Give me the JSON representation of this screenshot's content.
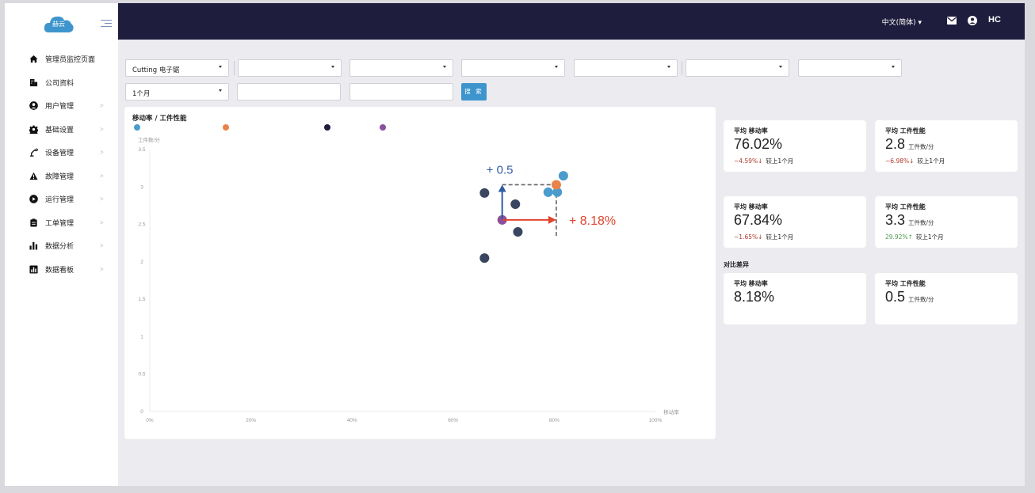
{
  "app": {
    "logo_text": "赫云",
    "accent": "#3e95cd",
    "topbar_color": "#1f1d3d"
  },
  "topbar": {
    "language": "中文(简体) ▾",
    "icons": [
      "mail-icon",
      "user-circle-icon",
      "hc-logo-icon"
    ],
    "hc_text": "HC"
  },
  "sidebar": {
    "items": [
      {
        "label": "管理员监控页面",
        "icon": "home-icon",
        "chevron": false
      },
      {
        "label": "公司资料",
        "icon": "building-icon",
        "chevron": false
      },
      {
        "label": "用户管理",
        "icon": "user-circle-icon",
        "chevron": true
      },
      {
        "label": "基础设置",
        "icon": "gear-icon",
        "chevron": true
      },
      {
        "label": "设备管理",
        "icon": "robot-arm-icon",
        "chevron": true
      },
      {
        "label": "故障管理",
        "icon": "warning-icon",
        "chevron": true
      },
      {
        "label": "运行管理",
        "icon": "play-icon",
        "chevron": true
      },
      {
        "label": "工单管理",
        "icon": "clipboard-icon",
        "chevron": true
      },
      {
        "label": "数据分析",
        "icon": "bar-chart-icon",
        "chevron": true
      },
      {
        "label": "数据看板",
        "icon": "dashboard-icon",
        "chevron": true
      }
    ],
    "chevron_glyph": ">"
  },
  "filters": {
    "row1": [
      "Cutting 电子锯",
      "",
      "",
      "",
      "",
      "",
      ""
    ],
    "period": "1个月",
    "search_label": "搜 索"
  },
  "chart": {
    "title": "移动率 / 工件性能",
    "y_unit": "工件数/分",
    "x_axis_label": "移动率",
    "annotation_up": "+ 0.5",
    "annotation_right": "+ 8.18%"
  },
  "chart_data": {
    "type": "scatter",
    "title": "移动率 / 工件性能",
    "xlabel": "移动率",
    "ylabel": "工件数/分",
    "xlim": [
      0,
      100
    ],
    "ylim": [
      0,
      3.5
    ],
    "x_ticks": [
      "0%",
      "20%",
      "40%",
      "60%",
      "80%",
      "100%"
    ],
    "y_ticks": [
      "0",
      "0.5",
      "1",
      "1.5",
      "2",
      "2.5",
      "3",
      "3.5"
    ],
    "legend_colors": [
      "#4b9ccc",
      "#e8834a",
      "#1f1d3d",
      "#8b4f9e"
    ],
    "series": [
      {
        "color": "#4b9ccc",
        "points": [
          [
            81.8,
            3.15
          ],
          [
            78.8,
            2.93
          ],
          [
            80.6,
            2.93
          ]
        ]
      },
      {
        "color": "#e8834a",
        "points": [
          [
            80.4,
            3.03
          ]
        ]
      },
      {
        "color": "#3a4660",
        "points": [
          [
            66.2,
            2.92
          ],
          [
            72.3,
            2.77
          ],
          [
            72.8,
            2.4
          ],
          [
            66.2,
            2.05
          ]
        ]
      },
      {
        "color": "#8b4f9e",
        "points": [
          [
            69.7,
            2.56
          ]
        ]
      }
    ],
    "annotations": {
      "arrow_up": {
        "from": [
          69.7,
          2.56
        ],
        "to": [
          69.7,
          3.03
        ],
        "label": "+ 0.5",
        "color": "#2f5ba3"
      },
      "arrow_right": {
        "from": [
          69.7,
          2.56
        ],
        "to": [
          80.4,
          2.56
        ],
        "label": "+ 8.18%",
        "color": "#e0452f"
      },
      "dashed_guide": {
        "from": [
          69.7,
          3.03
        ],
        "corner": [
          80.4,
          3.03
        ],
        "to": [
          80.4,
          2.33
        ]
      }
    }
  },
  "stats": {
    "top": {
      "util": {
        "label": "平均 移动率",
        "value": "76.02%",
        "delta": "−4.59%",
        "arrow": "↓",
        "cmp": "较上1个月",
        "delta_color": "#b03a2e"
      },
      "perf": {
        "label": "平均 工件性能",
        "value": "2.8",
        "unit": "工件数/分",
        "delta": "−6.98%",
        "arrow": "↓",
        "cmp": "较上1个月",
        "delta_color": "#b03a2e"
      }
    },
    "mid": {
      "util": {
        "label": "平均 移动率",
        "value": "67.84%",
        "delta": "−1.65%",
        "arrow": "↓",
        "cmp": "较上1个月",
        "delta_color": "#b03a2e"
      },
      "perf": {
        "label": "平均 工件性能",
        "value": "3.3",
        "unit": "工件数/分",
        "delta": "29.92%",
        "arrow": "↑",
        "cmp": "较上1个月",
        "delta_color": "#4a9a4a"
      }
    },
    "diff_title": "对比差异",
    "diff": {
      "util": {
        "label": "平均 移动率",
        "value": "8.18%"
      },
      "perf": {
        "label": "平均 工件性能",
        "value": "0.5",
        "unit": "工件数/分"
      }
    }
  }
}
